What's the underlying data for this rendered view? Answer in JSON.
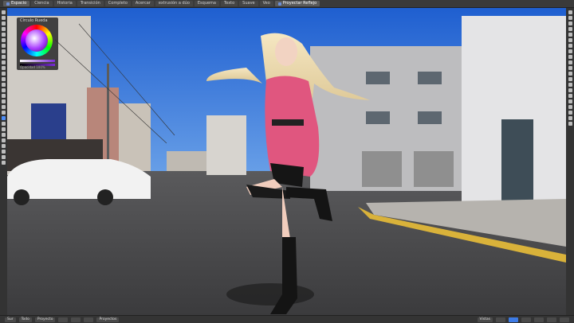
{
  "tabs": [
    {
      "label": "Espacio"
    },
    {
      "label": "Ciencia"
    },
    {
      "label": "Historia"
    },
    {
      "label": "Transición"
    },
    {
      "label": "Completo"
    },
    {
      "label": "Acercar"
    },
    {
      "label": "extrusión a dúo"
    },
    {
      "label": "Esquema"
    },
    {
      "label": "Texto"
    },
    {
      "label": "Suave"
    },
    {
      "label": "Veo"
    },
    {
      "label": "Proyectar Reflejo"
    }
  ],
  "color_panel": {
    "title": "Círculo Rueda",
    "label": "Opacidad 100%"
  },
  "bottom": {
    "left_buttons": [
      "Sur",
      "Todo",
      "Proyecto",
      "",
      "",
      "",
      "Proyectos"
    ],
    "right_buttons": [
      "Vistas",
      "",
      "",
      "",
      "",
      "",
      ""
    ]
  },
  "colors": {
    "sky": "#2f6fd6",
    "road": "#4a4a4c",
    "jacket": "#e0567f",
    "accent": "#3d7be6"
  }
}
